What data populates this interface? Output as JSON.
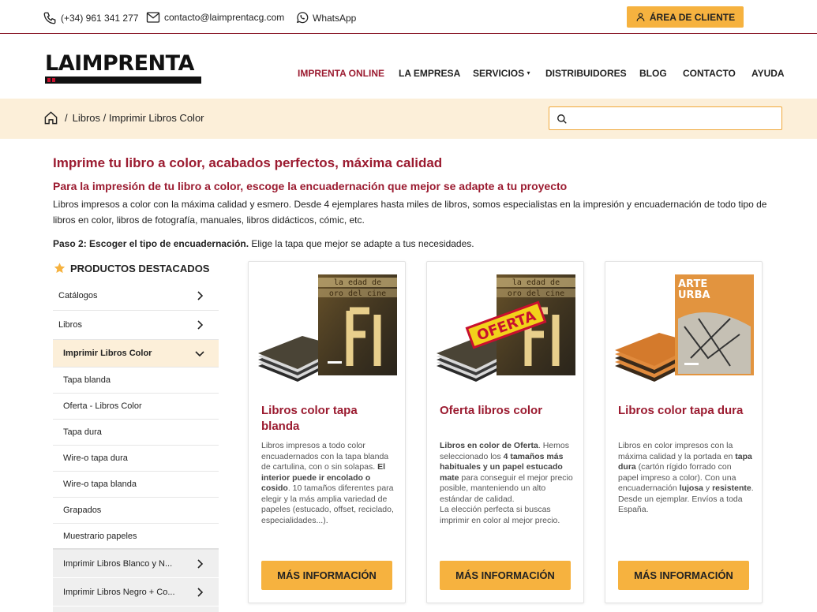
{
  "topbar": {
    "phone": "(+34) 961 341 277",
    "email": "contacto@laimprentacg.com",
    "whatsapp": "WhatsApp",
    "area_cliente": "ÁREA DE CLIENTE"
  },
  "header": {
    "logo_text": "LAIMPRENTA",
    "nav": [
      "IMPRENTA ONLINE",
      "LA EMPRESA",
      "SERVICIOS",
      "DISTRIBUIDORES",
      "BLOG",
      "CONTACTO",
      "AYUDA"
    ],
    "active_nav": "IMPRENTA ONLINE"
  },
  "breadcrumb": {
    "sep": "/",
    "text": "Libros / Imprimir Libros Color"
  },
  "search": {
    "placeholder": ""
  },
  "intro": {
    "title": "Imprime tu libro a color, acabados perfectos, máxima calidad",
    "subtitle": "Para la impresión de tu libro a color, escoge la encuadernación que mejor se adapte a tu proyecto",
    "text": "Libros impresos a color con la máxima calidad y esmero. Desde 4 ejemplares hasta miles de libros, somos especialistas en la impresión y encuadernación de todo tipo de libros en color, libros de fotografía, manuales, libros didácticos, cómic, etc.",
    "step_bold": "Paso 2: Escoger el tipo de encuadernación.",
    "step_rest": " Elige la tapa que mejor se adapte a tus necesidades."
  },
  "sidebar": {
    "title": "PRODUCTOS DESTACADOS",
    "items": [
      {
        "label": "Catálogos"
      },
      {
        "label": "Libros"
      },
      {
        "label": "Imprimir Libros Color"
      },
      {
        "label": "Tapa blanda"
      },
      {
        "label": "Oferta - Libros Color"
      },
      {
        "label": "Tapa dura"
      },
      {
        "label": "Wire-o tapa dura"
      },
      {
        "label": "Wire-o tapa blanda"
      },
      {
        "label": "Grapados"
      },
      {
        "label": "Muestrario papeles"
      },
      {
        "label": "Imprimir Libros Blanco y N..."
      },
      {
        "label": "Imprimir Libros Negro + Co..."
      }
    ]
  },
  "cards": [
    {
      "title": "Libros color tapa blanda",
      "cover_text_1": "la edad de",
      "cover_text_2": "oro del cine",
      "desc_1": "Libros impresos a todo color encuadernados con la tapa blanda de cartulina, con o sin solapas. ",
      "desc_2": "El interior puede ir encolado o cosido",
      "desc_3": ". 10 tamaños diferentes para elegir y la más amplia variedad de papeles (estucado, offset, reciclado, especialidades...).",
      "button": "MÁS INFORMACIÓN"
    },
    {
      "title": "Oferta libros color",
      "cover_text_1": "la edad de",
      "cover_text_2": "oro del cine",
      "badge": "OFERTA",
      "desc_1": "Libros en color de Oferta",
      "desc_2": ". Hemos seleccionado los ",
      "desc_3": "4 tamaños más habituales y un papel estucado mate",
      "desc_4": " para conseguir el mejor precio posible, manteniendo un alto estándar de calidad.",
      "desc_5": "La elección perfecta si buscas imprimir en color al mejor precio.",
      "button": "MÁS INFORMACIÓN"
    },
    {
      "title": "Libros color tapa dura",
      "cover_text_1": "ARTE",
      "cover_text_2": "URBA",
      "desc_1": "Libros en color impresos con la máxima calidad y la portada en ",
      "desc_2": "tapa dura",
      "desc_3": " (cartón rígido forrado con papel impreso a color). Con una encuadernación ",
      "desc_4": "lujosa",
      "desc_5": " y ",
      "desc_6": "resistente",
      "desc_7": ". Desde un ejemplar. Envíos a toda España.",
      "button": "MÁS INFORMACIÓN"
    }
  ],
  "colors": {
    "brand": "#9b1b30",
    "accent": "#f6b23f",
    "band": "#fcefd9"
  }
}
